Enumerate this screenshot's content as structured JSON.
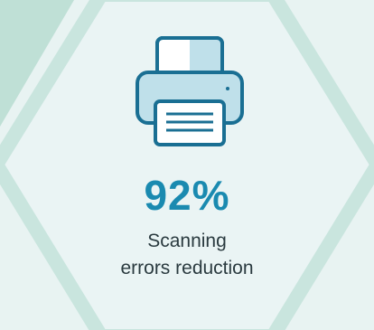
{
  "stat": {
    "value": "92%",
    "label_line1": "Scanning",
    "label_line2": "errors reduction"
  },
  "icon": "printer-icon",
  "colors": {
    "background": "#e8f3f2",
    "hexagon_fill": "#eaf4f4",
    "hexagon_border": "#c9e5de",
    "corner_accent": "#bfe0d6",
    "stat_value": "#1a8ab0",
    "stat_label": "#2a3a3f",
    "printer_outline": "#1a6f93",
    "printer_fill": "#ffffff",
    "printer_shade": "#bfe0ea"
  }
}
